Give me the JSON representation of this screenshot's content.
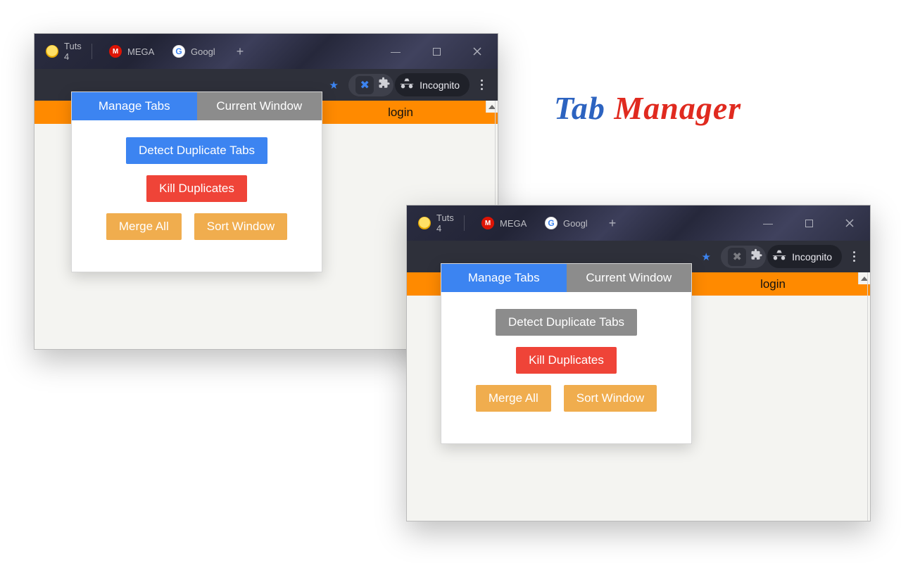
{
  "brand": {
    "word1": "Tab",
    "word2": "Manager"
  },
  "browser": {
    "tabs": {
      "tuts4": "Tuts 4",
      "mega": "MEGA",
      "googl": "Googl",
      "mega_letter": "M",
      "googl_letter": "G"
    },
    "newtab_glyph": "+",
    "window_controls": {
      "minimize": "—"
    },
    "incognito_label": "Incognito",
    "star_glyph": "★",
    "ext_glyph": "✖"
  },
  "page": {
    "login": "login"
  },
  "popup": {
    "tabs": {
      "manage": "Manage Tabs",
      "current": "Current Window"
    },
    "buttons": {
      "detect": "Detect Duplicate Tabs",
      "kill": "Kill Duplicates",
      "merge": "Merge All",
      "sort": "Sort Window"
    }
  }
}
